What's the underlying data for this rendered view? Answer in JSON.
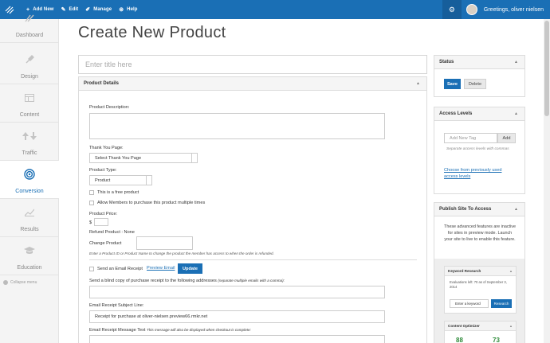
{
  "topbar": {
    "add_new": "Add New",
    "edit": "Edit",
    "manage": "Manage",
    "help": "Help",
    "greeting": "Greetings, oliver nielsen"
  },
  "sidebar": {
    "items": [
      {
        "label": "Dashboard",
        "icon": "dashboard-icon"
      },
      {
        "label": "Design",
        "icon": "brush-icon"
      },
      {
        "label": "Content",
        "icon": "content-icon"
      },
      {
        "label": "Traffic",
        "icon": "traffic-icon"
      },
      {
        "label": "Conversion",
        "icon": "target-icon",
        "active": true
      },
      {
        "label": "Results",
        "icon": "chart-icon"
      },
      {
        "label": "Education",
        "icon": "graduation-cap-icon"
      }
    ],
    "collapse": "Collapse menu"
  },
  "page": {
    "title": "Create New Product",
    "title_placeholder": "Enter title here"
  },
  "product_details": {
    "header": "Product Details",
    "description_label": "Product Description:",
    "thank_you_label": "Thank You Page:",
    "thank_you_value": "Select Thank You Page",
    "type_label": "Product Type:",
    "type_value": "Product",
    "free_label": "This is a free product",
    "multiple_label": "Allow Members to purchase this product multiple times",
    "price_label": "Product Price:",
    "currency": "$",
    "refund_label": "Refund Product : None",
    "change_label": "Change Product",
    "change_note": "Enter a Product ID or Product Name to change the product the member has access to when the order is refunded.",
    "email_receipt_label": "Send an Email Receipt",
    "preview_email": "Preview Email",
    "update_button": "Update",
    "bcc_label": "Send a blind copy of purchase receipt to the following addresses",
    "bcc_note": "(separate multiple emails with a comma):",
    "subject_label": "Email Receipt Subject Line:",
    "subject_value": "Receipt for purchase at oliver-nielsen.preview66.rmkr.net",
    "message_label": "Email Receipt Message Text",
    "message_note": "This message will also be displayed when checkout is complete:"
  },
  "status_box": {
    "header": "Status",
    "save": "Save",
    "delete": "Delete"
  },
  "access_box": {
    "header": "Access Levels",
    "placeholder": "Add New Tag",
    "add": "Add",
    "hint": "Separate access levels with commas",
    "choose_link": "Choose from previously used access levels"
  },
  "publish_box": {
    "header": "Publish Site To Access",
    "text": "These advanced features are inactive for sites in preview mode. Launch your site to live to enable this feature.",
    "keyword": {
      "header": "Keyword Research",
      "evaluations": "Evaluations left: 70 as of September 3, 2014",
      "placeholder": "Enter a keyword",
      "button": "Research"
    },
    "optimizer": {
      "header": "Content Optimizer",
      "score1": "88",
      "score2": "73"
    }
  },
  "colors": {
    "brand": "#1a6fb5",
    "score_green": "#2e8b3a"
  }
}
